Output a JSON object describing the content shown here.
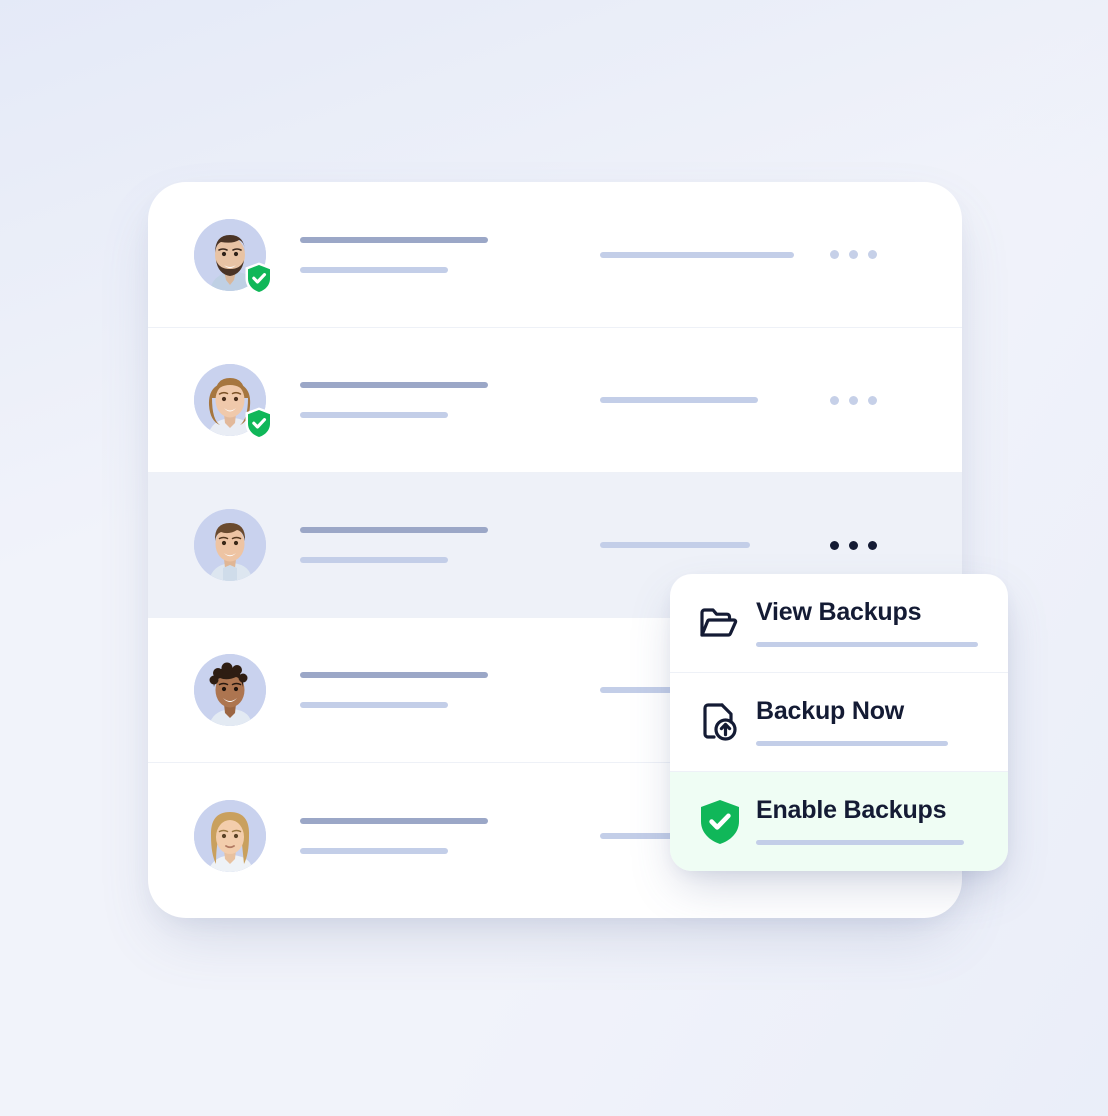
{
  "theme": {
    "page_bg": "#f1f3fa",
    "card_bg": "#ffffff",
    "active_row_bg": "#eef1f8",
    "highlight_bg": "#effdf4",
    "accent_green": "#10b759",
    "skeleton_primary": "#9ba7c7",
    "skeleton_secondary": "#c3cee8",
    "text_dark": "#141b34",
    "dots_idle": "#c6d0e8",
    "dots_active": "#141b34",
    "grid_line": "#dfe4f5"
  },
  "list": {
    "name": "user-backup-list",
    "rows": [
      {
        "id": "row-1",
        "avatar": "avatar-bearded-man",
        "verified": true,
        "active": false,
        "primary_bar_width": 188,
        "secondary_bar_width": 148,
        "meta_bar_width": 194,
        "menu_label": "row-actions"
      },
      {
        "id": "row-2",
        "avatar": "avatar-smiling-woman",
        "verified": true,
        "active": false,
        "primary_bar_width": 188,
        "secondary_bar_width": 148,
        "meta_bar_width": 158,
        "menu_label": "row-actions"
      },
      {
        "id": "row-3",
        "avatar": "avatar-young-man",
        "verified": false,
        "active": true,
        "primary_bar_width": 188,
        "secondary_bar_width": 148,
        "meta_bar_width": 150,
        "menu_label": "row-actions"
      },
      {
        "id": "row-4",
        "avatar": "avatar-curly-hair-man",
        "verified": false,
        "active": false,
        "primary_bar_width": 188,
        "secondary_bar_width": 148,
        "meta_bar_width": 150,
        "menu_label": "row-actions"
      },
      {
        "id": "row-5",
        "avatar": "avatar-blonde-woman",
        "verified": false,
        "active": false,
        "primary_bar_width": 188,
        "secondary_bar_width": 148,
        "meta_bar_width": 150,
        "menu_label": "row-actions"
      }
    ]
  },
  "context_menu": {
    "name": "backup-context-menu",
    "items": [
      {
        "label": "View Backups",
        "icon": "folder-open-icon",
        "highlighted": false,
        "underline_width": 222
      },
      {
        "label": "Backup Now",
        "icon": "file-upload-icon",
        "highlighted": false,
        "underline_width": 192
      },
      {
        "label": "Enable Backups",
        "icon": "shield-check-icon",
        "highlighted": true,
        "underline_width": 208
      }
    ]
  }
}
